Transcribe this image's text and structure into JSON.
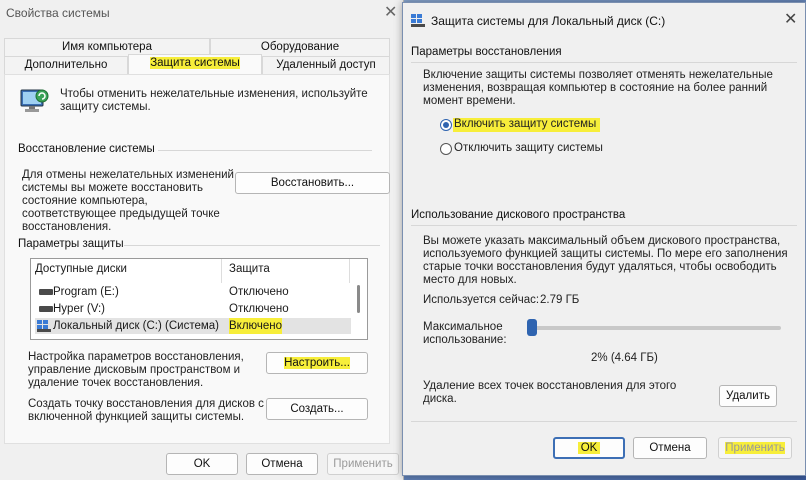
{
  "props": {
    "title": "Свойства системы",
    "tabs_top": [
      "Имя компьютера",
      "Оборудование"
    ],
    "tabs_bottom": [
      "Дополнительно",
      "Защита системы",
      "Удаленный доступ"
    ],
    "intro": [
      "Чтобы отменить нежелательные изменения, используйте",
      "защиту системы."
    ],
    "restore_header": "Восстановление системы",
    "restore_text": [
      "Для отмены нежелательных изменений",
      "системы вы можете восстановить",
      "состояние компьютера,",
      "соответствующее предыдущей точке",
      "восстановления."
    ],
    "restore_button": "Восстановить...",
    "params_header": "Параметры защиты",
    "col_drives": "Доступные диски",
    "col_protection": "Защита",
    "drives": [
      {
        "name": "Program (E:)",
        "protection": "Отключено"
      },
      {
        "name": "Hyper (V:)",
        "protection": "Отключено"
      },
      {
        "name": "Локальный диск (C:) (Система)",
        "protection": "Включено"
      }
    ],
    "configure_text": [
      "Настройка параметров восстановления,",
      "управление дисковым пространством и",
      "удаление точек восстановления."
    ],
    "configure_button": "Настроить...",
    "create_text": [
      "Создать точку восстановления для дисков с",
      "включенной функцией защиты системы."
    ],
    "create_button": "Создать...",
    "ok": "OK",
    "cancel": "Отмена",
    "apply": "Применить"
  },
  "dialog": {
    "title": "Защита системы для Локальный диск (C:)",
    "restore_settings_header": "Параметры восстановления",
    "restore_settings_text": [
      "Включение защиты системы позволяет отменять нежелательные",
      "изменения, возвращая компьютер в состояние на более ранний",
      "момент времени."
    ],
    "radio_on": "Включить защиту системы",
    "radio_off": "Отключить защиту системы",
    "disk_usage_header": "Использование дискового пространства",
    "disk_usage_text": [
      "Вы можете указать максимальный объем дискового пространства,",
      "используемого функцией защиты системы. По мере его заполнения",
      "старые точки восстановления будут удаляться, чтобы освободить",
      "место для новых."
    ],
    "current_usage_label": "Используется сейчас:",
    "current_usage_value": "2.79 ГБ",
    "max_usage_label": [
      "Максимальное",
      "использование:"
    ],
    "max_usage_value": "2% (4.64 ГБ)",
    "max_usage_percent": 2,
    "delete_text": [
      "Удаление всех точек восстановления для этого",
      "диска."
    ],
    "delete_button": "Удалить",
    "ok": "OK",
    "cancel": "Отмена",
    "apply": "Применить"
  },
  "colors": {
    "highlight": "#f7ee3a",
    "accent": "#2f64b0"
  }
}
